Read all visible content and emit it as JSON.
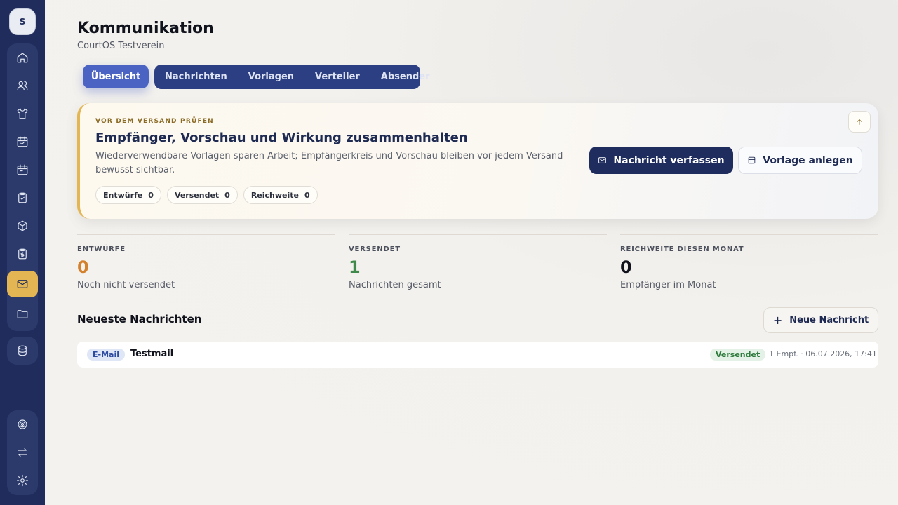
{
  "sidebar": {
    "avatar_initial": "S",
    "items": [
      {
        "icon": "home-icon"
      },
      {
        "icon": "users-icon"
      },
      {
        "icon": "shirt-icon"
      },
      {
        "icon": "calendar-check-icon"
      },
      {
        "icon": "calendar-icon"
      },
      {
        "icon": "clipboard-check-icon"
      },
      {
        "icon": "package-icon"
      },
      {
        "icon": "receipt-icon"
      },
      {
        "icon": "mail-icon",
        "active": true
      },
      {
        "icon": "folder-icon"
      }
    ],
    "db_icon": "database-icon",
    "bottom_items": [
      {
        "icon": "target-icon"
      },
      {
        "icon": "arrows-swap-icon"
      },
      {
        "icon": "gear-icon"
      }
    ]
  },
  "header": {
    "title": "Kommunikation",
    "subtitle": "CourtOS Testverein"
  },
  "tabs": {
    "active": "Übersicht",
    "others": [
      "Nachrichten",
      "Vorlagen",
      "Verteiler",
      "Absender"
    ]
  },
  "hero": {
    "kicker": "VOR DEM VERSAND PRÜFEN",
    "title": "Empfänger, Vorschau und Wirkung zusammenhalten",
    "text": "Wiederverwendbare Vorlagen sparen Arbeit; Empfängerkreis und Vorschau bleiben vor jedem Versand bewusst sichtbar.",
    "chips": [
      {
        "label": "Entwürfe",
        "value": "0"
      },
      {
        "label": "Versendet",
        "value": "0"
      },
      {
        "label": "Reichweite",
        "value": "0"
      }
    ],
    "primary_button": "Nachricht verfassen",
    "secondary_button": "Vorlage anlegen"
  },
  "stats": [
    {
      "label": "ENTWÜRFE",
      "value": "0",
      "sub": "Noch nicht versendet",
      "color": "#d4812e"
    },
    {
      "label": "VERSENDET",
      "value": "1",
      "sub": "Nachrichten gesamt",
      "color": "#3f8a4a"
    },
    {
      "label": "REICHWEITE DIESEN MONAT",
      "value": "0",
      "sub": "Empfänger im Monat",
      "color": "#10131c"
    }
  ],
  "messages": {
    "title": "Neueste Nachrichten",
    "new_button": "Neue Nachricht",
    "rows": [
      {
        "type": "E-Mail",
        "title": "Testmail",
        "status": "Versendet",
        "meta": "1 Empf. · 06.07.2026, 17:41"
      }
    ]
  }
}
